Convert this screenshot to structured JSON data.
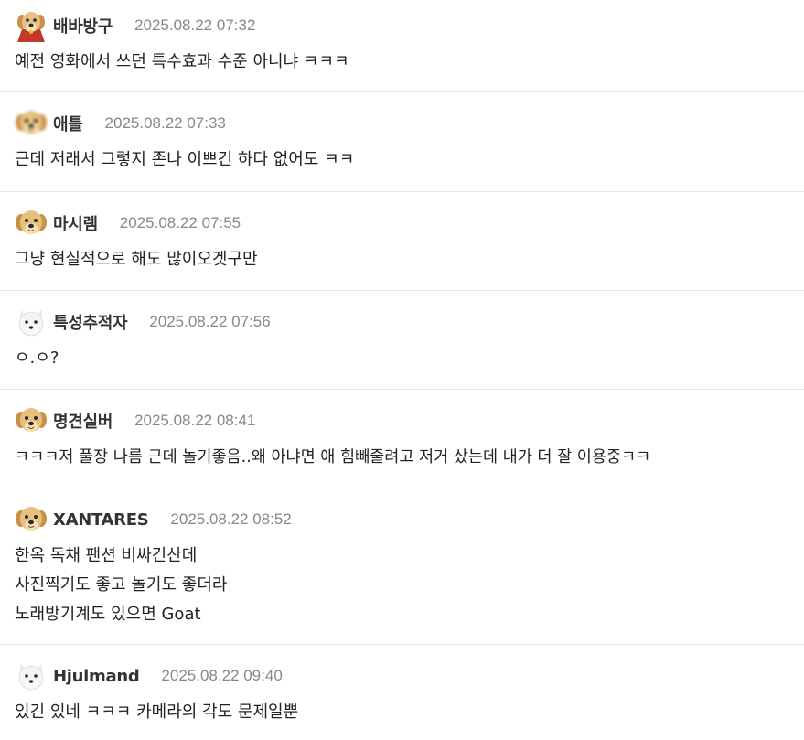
{
  "comments": [
    {
      "avatar_icon": "puppy-cape-avatar-icon",
      "nickname": "배바방구",
      "timestamp": "2025.08.22 07:32",
      "lines": [
        "예전 영화에서 쓰던 특수효과 수준 아니냐 ㅋㅋㅋ"
      ]
    },
    {
      "avatar_icon": "puppy-blurred-avatar-icon",
      "nickname": "애틀",
      "timestamp": "2025.08.22 07:33",
      "lines": [
        "근데 저래서 그렇지 존나 이쁘긴 하다 없어도 ㅋㅋ"
      ]
    },
    {
      "avatar_icon": "puppy-avatar-icon",
      "nickname": "마시렘",
      "timestamp": "2025.08.22 07:55",
      "lines": [
        "그냥 현실적으로 해도 많이오겟구만"
      ]
    },
    {
      "avatar_icon": "white-dog-avatar-icon",
      "nickname": "특성추적자",
      "timestamp": "2025.08.22 07:56",
      "lines": [
        "ㅇ.ㅇ?"
      ]
    },
    {
      "avatar_icon": "puppy-avatar-icon",
      "nickname": "명견실버",
      "timestamp": "2025.08.22 08:41",
      "lines": [
        "ㅋㅋㅋ저 풀장 나름 근데 놀기좋음..왜 아냐면 애 힘빼줄려고 저거 샀는데 내가 더 잘 이용중ㅋㅋ"
      ]
    },
    {
      "avatar_icon": "puppy-avatar-icon",
      "nickname": "XANTARES",
      "timestamp": "2025.08.22 08:52",
      "lines": [
        "한옥 독채 팬션 비싸긴산데",
        "사진찍기도 좋고 놀기도 좋더라",
        "노래방기계도 있으면 Goat"
      ]
    },
    {
      "avatar_icon": "white-dog-avatar-icon",
      "nickname": "Hjulmand",
      "timestamp": "2025.08.22 09:40",
      "lines": [
        "있긴 있네 ㅋㅋㅋ 카메라의 각도 문제일뿐"
      ]
    }
  ],
  "colors": {
    "nickname": "#333333",
    "timestamp": "#888888",
    "body_text": "#222222",
    "divider": "#e6e6e6",
    "puppy_fur": "#e3b872",
    "white_dog_fur": "#f2f2f2",
    "cape": "#c0392b"
  }
}
